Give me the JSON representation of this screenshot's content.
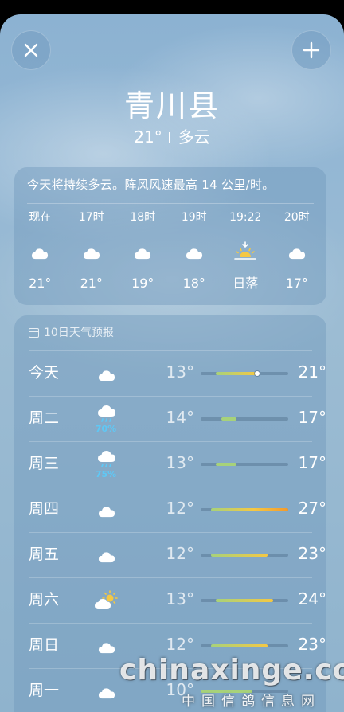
{
  "header": {
    "city": "青川县",
    "temperature": "21°",
    "condition": "多云"
  },
  "hourly": {
    "summary": "今天将持续多云。阵风风速最高 14 公里/时。",
    "items": [
      {
        "time": "现在",
        "icon": "cloud-icon",
        "temp": "21°"
      },
      {
        "time": "17时",
        "icon": "cloud-icon",
        "temp": "21°"
      },
      {
        "time": "18时",
        "icon": "cloud-icon",
        "temp": "19°"
      },
      {
        "time": "19时",
        "icon": "cloud-icon",
        "temp": "18°"
      },
      {
        "time": "19:22",
        "icon": "sunset-icon",
        "temp": "日落"
      },
      {
        "time": "20时",
        "icon": "cloud-icon",
        "temp": "17°"
      }
    ]
  },
  "daily": {
    "title": "10日天气预报",
    "range": {
      "min": 10,
      "max": 27
    },
    "days": [
      {
        "day": "今天",
        "icon": "cloud-icon",
        "precip": "",
        "low": "13°",
        "high": "21°",
        "lo": 13,
        "hi": 21,
        "current": 21
      },
      {
        "day": "周二",
        "icon": "rain-cloud-icon",
        "precip": "70%",
        "low": "14°",
        "high": "17°",
        "lo": 14,
        "hi": 17
      },
      {
        "day": "周三",
        "icon": "rain-cloud-icon",
        "precip": "75%",
        "low": "13°",
        "high": "17°",
        "lo": 13,
        "hi": 17
      },
      {
        "day": "周四",
        "icon": "cloud-icon",
        "precip": "",
        "low": "12°",
        "high": "27°",
        "lo": 12,
        "hi": 27
      },
      {
        "day": "周五",
        "icon": "cloud-icon",
        "precip": "",
        "low": "12°",
        "high": "23°",
        "lo": 12,
        "hi": 23
      },
      {
        "day": "周六",
        "icon": "partly-sunny-icon",
        "precip": "",
        "low": "13°",
        "high": "24°",
        "lo": 13,
        "hi": 24
      },
      {
        "day": "周日",
        "icon": "cloud-icon",
        "precip": "",
        "low": "12°",
        "high": "23°",
        "lo": 12,
        "hi": 23
      },
      {
        "day": "周一",
        "icon": "cloud-icon",
        "precip": "",
        "low": "10°",
        "high": "",
        "lo": 10,
        "hi": 20
      }
    ]
  },
  "watermark": {
    "text": "chinaxinge.com",
    "subtext": "中国信鸽信息网"
  },
  "colors": {
    "bar_cool": "#a7d27a",
    "bar_warm": "#f5c843",
    "bar_hot": "#f39a2b",
    "precip": "#5fc8f5"
  }
}
